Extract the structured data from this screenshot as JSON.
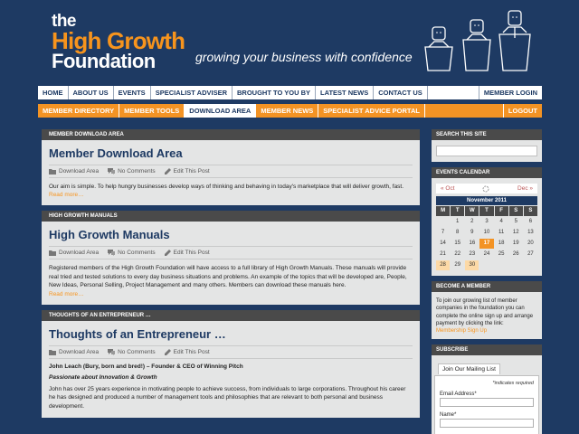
{
  "brand": {
    "the": "the",
    "high_growth": "High Growth",
    "foundation": "Foundation",
    "tagline": "growing your business with confidence"
  },
  "nav_primary": [
    {
      "label": "HOME"
    },
    {
      "label": "ABOUT US"
    },
    {
      "label": "EVENTS"
    },
    {
      "label": "SPECIALIST ADVISER"
    },
    {
      "label": "BROUGHT TO YOU BY"
    },
    {
      "label": "LATEST NEWS"
    },
    {
      "label": "CONTACT US"
    }
  ],
  "nav_primary_right": "MEMBER LOGIN",
  "nav_secondary": [
    {
      "label": "MEMBER DIRECTORY"
    },
    {
      "label": "MEMBER TOOLS"
    },
    {
      "label": "DOWNLOAD AREA",
      "active": true
    },
    {
      "label": "MEMBER NEWS"
    },
    {
      "label": "SPECIALIST ADVICE PORTAL"
    }
  ],
  "nav_secondary_right": "LOGOUT",
  "posts": [
    {
      "section": "MEMBER DOWNLOAD AREA",
      "title": "Member Download Area",
      "meta": {
        "category": "Download Area",
        "comments": "No Comments",
        "edit": "Edit This Post"
      },
      "text": "Our aim is simple.  To help hungry businesses develop ways of thinking and behaving in today's marketplace that will deliver growth, fast.",
      "more": "Read more…"
    },
    {
      "section": "HIGH GROWTH MANUALS",
      "title": "High Growth Manuals",
      "meta": {
        "category": "Download Area",
        "comments": "No Comments",
        "edit": "Edit This Post"
      },
      "text": "Registered members of the High Growth Foundation will  have access to a full library of High Growth Manuals.  These manuals will provide real tried and tested solutions to every day business situations and problems.   An example of the topics that will be developed are,  People, New Ideas, Personal Selling, Project Management and many others.  Members can download these manuals here.",
      "more": "Read more…"
    },
    {
      "section": "THOUGHTS OF AN ENTREPRENEUR …",
      "title": "Thoughts of an Entrepreneur …",
      "meta": {
        "category": "Download Area",
        "comments": "No Comments",
        "edit": "Edit This Post"
      },
      "author": "John Leach (Bury, born and bred!) – Founder & CEO of Winning Pitch",
      "passion": "Passionate about Innovation & Growth",
      "text": "John has over 25 years experience in motivating people to achieve success, from individuals to large corporations. Throughout his career he has designed and produced a number of management tools and philosophies that are relevant to both personal and business development."
    }
  ],
  "sidebar": {
    "search_title": "SEARCH THIS SITE",
    "events_title": "EVENTS CALENDAR",
    "calendar": {
      "prev": "« Oct",
      "next": "Dec »",
      "month": "November 2011",
      "days": [
        "M",
        "T",
        "W",
        "T",
        "F",
        "S",
        "S"
      ],
      "leading_blanks": 1,
      "count": 30,
      "today": 17,
      "highlight": [
        28,
        30
      ],
      "today_color": "#f39324"
    },
    "become_title": "BECOME A MEMBER",
    "become_text": "To join our growing list of member companies in the foundation you can complete the online sign up and arrange payment by clicking the link:",
    "become_link": "Membership Sign Up",
    "subscribe_title": "SUBSCRIBE",
    "mailing_tab": "Join Our Mailing List",
    "required_note": "*indicates required",
    "email_label": "Email Address*",
    "name_label": "Name*"
  },
  "colors": {
    "background": "#1e3a63",
    "accent": "#f39324",
    "panel": "#e4e5e5",
    "header_bar": "#4a4a4a"
  }
}
